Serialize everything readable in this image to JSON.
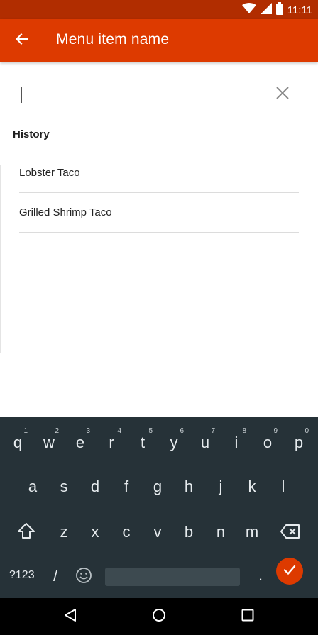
{
  "status_bar": {
    "time": "11:11"
  },
  "app_bar": {
    "title": "Menu item name"
  },
  "search": {
    "value": "",
    "placeholder": ""
  },
  "history": {
    "heading": "History",
    "items": [
      "Lobster Taco",
      "Grilled Shrimp Taco"
    ]
  },
  "keyboard": {
    "row1": [
      {
        "ch": "q",
        "hint": "1"
      },
      {
        "ch": "w",
        "hint": "2"
      },
      {
        "ch": "e",
        "hint": "3"
      },
      {
        "ch": "r",
        "hint": "4"
      },
      {
        "ch": "t",
        "hint": "5"
      },
      {
        "ch": "y",
        "hint": "6"
      },
      {
        "ch": "u",
        "hint": "7"
      },
      {
        "ch": "i",
        "hint": "8"
      },
      {
        "ch": "o",
        "hint": "9"
      },
      {
        "ch": "p",
        "hint": "0"
      }
    ],
    "row2": [
      "a",
      "s",
      "d",
      "f",
      "g",
      "h",
      "j",
      "k",
      "l"
    ],
    "row3": [
      "z",
      "x",
      "c",
      "v",
      "b",
      "n",
      "m"
    ],
    "symbols_label": "?123",
    "slash_label": "/",
    "period_label": "."
  },
  "colors": {
    "status_bar": "#b12d00",
    "app_bar": "#dd3a00",
    "keyboard_bg": "#263238",
    "accent": "#dd3a00"
  },
  "icons": {
    "back": "arrow-left-icon",
    "clear": "close-icon",
    "shift": "shift-icon",
    "backspace": "backspace-icon",
    "emoji": "emoji-icon",
    "enter": "checkmark-icon",
    "wifi": "wifi-icon",
    "signal": "signal-icon",
    "battery": "battery-icon",
    "nav_back": "triangle-back-icon",
    "nav_home": "circle-home-icon",
    "nav_recents": "square-recents-icon"
  }
}
